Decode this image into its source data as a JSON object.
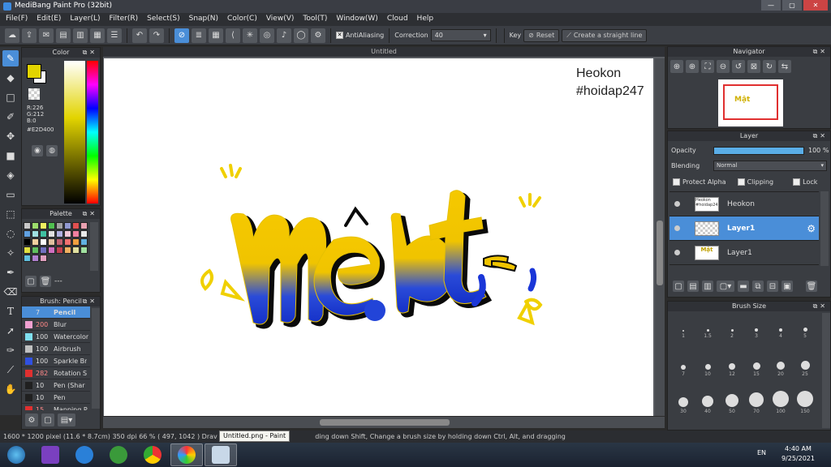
{
  "window": {
    "title": "MediBang Paint Pro (32bit)",
    "min": "—",
    "max": "▢",
    "close": "✕"
  },
  "menu": [
    "File(F)",
    "Edit(E)",
    "Layer(L)",
    "Filter(R)",
    "Select(S)",
    "Snap(N)",
    "Color(C)",
    "View(V)",
    "Tool(T)",
    "Window(W)",
    "Cloud",
    "Help"
  ],
  "toolbar": {
    "antialias_label": "AntiAliasing",
    "correction_label": "Correction",
    "correction_value": "40",
    "key_label": "Key",
    "reset_label": "Reset",
    "straight_line_label": "Create a straight line"
  },
  "color_panel": {
    "title": "Color",
    "r": "R:226",
    "g": "G:212",
    "b": "B:0",
    "hex": "#E2D400",
    "fg_color": "#E2D400"
  },
  "palette_panel": {
    "title": "Palette",
    "colors": [
      "#c8c8c8",
      "#9cdc6c",
      "#f0f060",
      "#50c050",
      "#a0a0a0",
      "#9098d0",
      "#e05050",
      "#e8a0b0",
      "#60a0e0",
      "#a0e0e0",
      "#40c0a0",
      "#e0e0e0",
      "#b0b0e0",
      "#f0c8d8",
      "#f080a0",
      "#e8e8e8",
      "#000000",
      "#f0d0a0",
      "#ffffff",
      "#e0c0a0",
      "#c06070",
      "#f07070",
      "#f0a040",
      "#60b0e0",
      "#e0e040",
      "#60c060",
      "#7070c0",
      "#d070c0",
      "#c04050",
      "#f0b060",
      "#e0e0a0",
      "#a0e0a0",
      "#60c0e0",
      "#b080d0",
      "#e0a0c0"
    ],
    "footer": "---"
  },
  "brush_panel": {
    "title": "Brush: Pencil",
    "brushes": [
      {
        "size": "7",
        "name": "Pencil",
        "color": "#4a8ed8"
      },
      {
        "size": "200",
        "name": "Blur",
        "color": "#f0a0d0"
      },
      {
        "size": "100",
        "name": "Watercolor",
        "color": "#80e0f0"
      },
      {
        "size": "100",
        "name": "Airbrush",
        "color": "#c0c0c0"
      },
      {
        "size": "100",
        "name": "Sparkle Br",
        "color": "#3050e0"
      },
      {
        "size": "282",
        "name": "Rotation S",
        "color": "#e03030"
      },
      {
        "size": "10",
        "name": "Pen (Shar",
        "color": "#202020"
      },
      {
        "size": "10",
        "name": "Pen",
        "color": "#202020"
      },
      {
        "size": "15",
        "name": "Mapping P",
        "color": "#e03030"
      }
    ]
  },
  "canvas": {
    "tab": "Untitled",
    "watermark_line1": "Heokon",
    "watermark_line2": "#hoidap247",
    "lettering": "Mật"
  },
  "navigator": {
    "title": "Navigator"
  },
  "layer_panel": {
    "title": "Layer",
    "opacity_label": "Opacity",
    "opacity_value": "100 %",
    "opacity_fraction": 1.0,
    "blending_label": "Blending",
    "blending_value": "Normal",
    "protect_alpha": "Protect Alpha",
    "clipping": "Clipping",
    "lock": "Lock",
    "layers": [
      {
        "name": "Heokon",
        "thumb": "Heokon #hoidap247"
      },
      {
        "name": "Layer1",
        "thumb": ""
      },
      {
        "name": "Layer1",
        "thumb": "Mật"
      }
    ]
  },
  "brush_size_panel": {
    "title": "Brush Size",
    "sizes": [
      "1",
      "1.5",
      "2",
      "3",
      "4",
      "5",
      "7",
      "10",
      "12",
      "15",
      "20",
      "25",
      "30",
      "40",
      "50",
      "70",
      "100",
      "150"
    ]
  },
  "status": {
    "dimensions": "1600 * 1200 pixel",
    "physical": "(11.6 * 8.7cm)",
    "dpi": "350 dpi",
    "zoom": "66 %",
    "coords": "( 497, 1042 )",
    "hint_start": "Drav",
    "hint_rest": "ding down Shift, Change a brush size by holding down Ctrl, Alt, and dragging"
  },
  "tooltip": "Untitled.png - Paint",
  "taskbar": {
    "lang": "EN",
    "time": "4:40 AM",
    "date": "9/25/2021"
  }
}
